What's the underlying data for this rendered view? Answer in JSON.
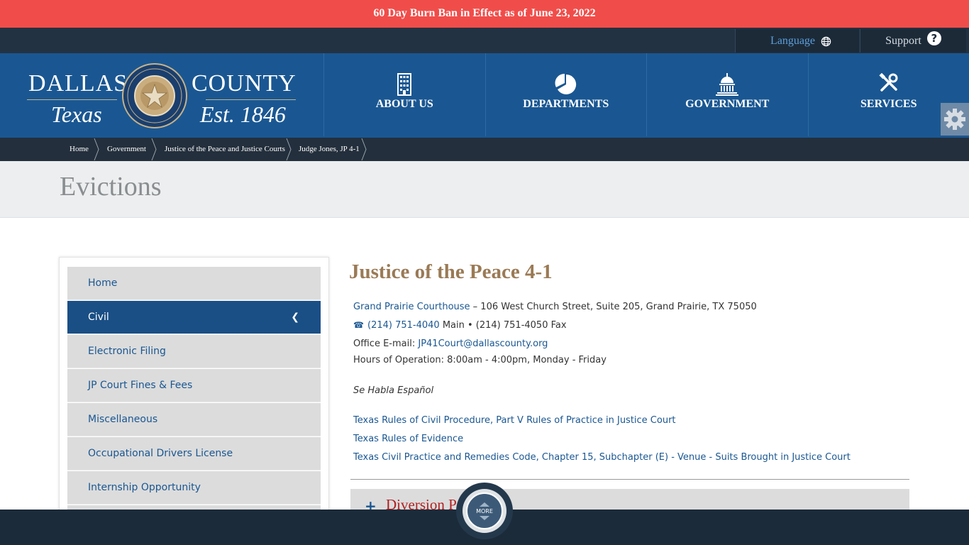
{
  "alert": {
    "text": "60 Day Burn Ban in Effect as of June 23, 2022"
  },
  "utility": {
    "language_label": "Language",
    "support_label": "Support"
  },
  "logo": {
    "left_top": "DALLAS",
    "right_top": "COUNTY",
    "left_bottom": "Texas",
    "right_bottom": "Est. 1846"
  },
  "nav": {
    "items": [
      {
        "label": "ABOUT US",
        "icon": "building-icon"
      },
      {
        "label": "DEPARTMENTS",
        "icon": "pie-chart-icon"
      },
      {
        "label": "GOVERNMENT",
        "icon": "capitol-icon"
      },
      {
        "label": "SERVICES",
        "icon": "tools-icon"
      }
    ]
  },
  "breadcrumb": [
    "Home",
    "Government",
    "Justice of the Peace and Justice Courts",
    "Judge Jones, JP 4-1"
  ],
  "page": {
    "title": "Evictions"
  },
  "sidebar": {
    "items": [
      {
        "label": "Home",
        "active": false
      },
      {
        "label": "Civil",
        "active": true
      },
      {
        "label": "Electronic Filing",
        "active": false
      },
      {
        "label": "JP Court Fines & Fees",
        "active": false
      },
      {
        "label": "Miscellaneous",
        "active": false
      },
      {
        "label": "Occupational Drivers License",
        "active": false
      },
      {
        "label": "Internship Opportunity",
        "active": false
      }
    ]
  },
  "main": {
    "heading": "Justice of the Peace 4-1",
    "courthouse_link": "Grand Prairie Courthouse",
    "address": " – 106 West Church Street, Suite 205, Grand Prairie, TX 75050",
    "phone_main": "(214) 751-4040",
    "phone_main_suffix": " Main • (214) 751-4050 Fax",
    "email_label": "Office E-mail: ",
    "email": "JP41Court@dallascounty.org",
    "hours": "Hours of Operation: 8:00am - 4:00pm, Monday - Friday",
    "spanish": "Se Habla Español",
    "links": [
      "Texas Rules of Civil Procedure, Part V Rules of Practice in Justice Court",
      "Texas Rules of Evidence",
      "Texas Civil Practice and Remedies Code, Chapter 15, Subchapter (E) - Venue - Suits Brought in Justice Court"
    ],
    "accordion_title": "Diversion P"
  },
  "more": {
    "label": "MORE"
  },
  "colors": {
    "alert": "#f04d4a",
    "header": "#1a5792",
    "accent_gold": "#9a7a55"
  }
}
